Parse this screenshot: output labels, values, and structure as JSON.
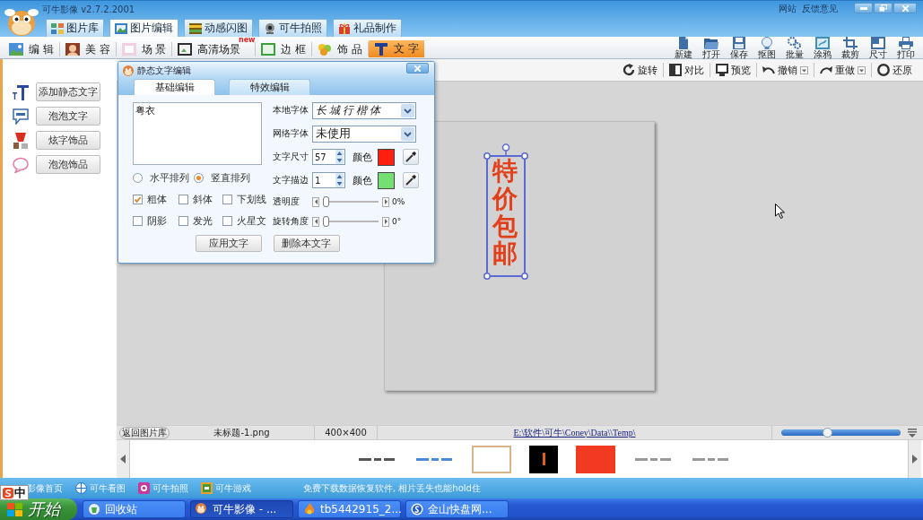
{
  "window": {
    "title": "可牛影像 v2.7.2.2001",
    "links": [
      "网站",
      "反馈意见"
    ]
  },
  "main_tabs": [
    {
      "label": "图片库",
      "selected": false
    },
    {
      "label": "图片编辑",
      "selected": true
    },
    {
      "label": "动感闪图",
      "selected": false
    },
    {
      "label": "可牛拍照",
      "selected": false
    },
    {
      "label": "礼品制作",
      "selected": false
    }
  ],
  "edit_tabs": [
    {
      "label": "编 辑",
      "selected": false
    },
    {
      "label": "美 容",
      "selected": false
    },
    {
      "label": "场 景",
      "selected": false
    },
    {
      "label": "高清场景",
      "selected": false,
      "badge": "new"
    },
    {
      "label": "边 框",
      "selected": false
    },
    {
      "label": "饰 品",
      "selected": false
    },
    {
      "label": "文 字",
      "selected": true
    }
  ],
  "tools": [
    "新建",
    "打开",
    "保存",
    "抠图",
    "批量",
    "涂鸦",
    "裁剪",
    "尺寸",
    "打印"
  ],
  "left_panel": [
    "添加静态文字",
    "泡泡文字",
    "炫字饰品",
    "泡泡饰品"
  ],
  "canvas_toolbar": [
    {
      "label": "旋转",
      "dropdown": false
    },
    {
      "label": "对比",
      "dropdown": false
    },
    {
      "label": "预览",
      "dropdown": false
    },
    {
      "label": "撤销",
      "dropdown": true
    },
    {
      "label": "重做",
      "dropdown": true
    },
    {
      "label": "还原",
      "dropdown": false
    }
  ],
  "canvas": {
    "text": "特价包邮",
    "selected": true
  },
  "dialog": {
    "title": "静态文字编辑",
    "tabs": [
      {
        "label": "基础编辑",
        "selected": true
      },
      {
        "label": "特效编辑",
        "selected": false
      }
    ],
    "text_value": "粤衣",
    "layout_options": [
      {
        "label": "水平排列",
        "selected": false
      },
      {
        "label": "竖直排列",
        "selected": true
      }
    ],
    "styles": [
      {
        "label": "粗体",
        "checked": true
      },
      {
        "label": "斜体",
        "checked": false
      },
      {
        "label": "下划线",
        "checked": false
      },
      {
        "label": "阴影",
        "checked": false
      },
      {
        "label": "发光",
        "checked": false
      },
      {
        "label": "火星文",
        "checked": false
      }
    ],
    "local_font": {
      "label": "本地字体",
      "value": "长城行楷体"
    },
    "web_font": {
      "label": "网络字体",
      "value": "未使用"
    },
    "text_size": {
      "label": "文字尺寸",
      "value": "57",
      "color_label": "颜色",
      "color": "#ff2010"
    },
    "text_stroke": {
      "label": "文字描边",
      "value": "1",
      "color_label": "颜色",
      "color": "#74e074"
    },
    "opacity": {
      "label": "透明度",
      "level": 0,
      "reading": "0%"
    },
    "rotation": {
      "label": "旋转角度",
      "level": 0,
      "reading": "0°"
    },
    "buttons": [
      "应用文字",
      "删除本文字"
    ]
  },
  "info_bar": {
    "back_button": "返回图片库",
    "file_name": "未标题-1.png",
    "dimensions": "400×400",
    "path": "E:\\软件\\可牛\\Coney\\Data\\\\Temp\\",
    "zoom": {
      "level": 0.38
    }
  },
  "thumbnails": [
    {
      "kind": "sketch",
      "color": "#555555",
      "selected": false
    },
    {
      "kind": "sketch",
      "color": "#4a8ad8",
      "selected": false
    },
    {
      "kind": "plain",
      "color": "#ffffff",
      "selected": true
    },
    {
      "kind": "vertical-text",
      "color": "#000000",
      "selected": false
    },
    {
      "kind": "plain",
      "color": "#f23a22",
      "selected": false
    },
    {
      "kind": "sketch",
      "color": "#999999",
      "selected": false
    },
    {
      "kind": "sketch",
      "color": "#999999",
      "selected": false
    }
  ],
  "link_bar": {
    "links": [
      "影像首页",
      "可牛看图",
      "可牛拍照",
      "可牛游戏"
    ],
    "notice": "免费下载数据恢复软件, 相片丢失也能hold住"
  },
  "ime": {
    "label": "中"
  },
  "taskbar": {
    "start": "开始",
    "tasks": [
      {
        "label": "回收站",
        "selected": false
      },
      {
        "label": "可牛影像 - ...",
        "selected": true
      },
      {
        "label": "tb5442915_2...",
        "selected": false
      },
      {
        "label": "金山快盘网...",
        "selected": false
      }
    ]
  }
}
